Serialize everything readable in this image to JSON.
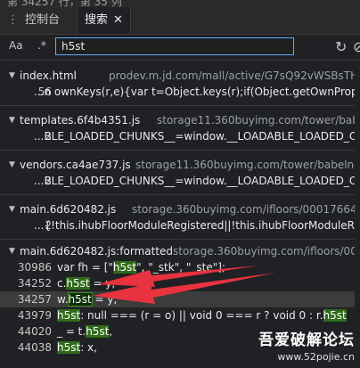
{
  "status": "第 34257 行，第 35 列",
  "tabs": {
    "console": "控制台",
    "search": "搜索",
    "close": "✕"
  },
  "search": {
    "case_toggle": "Aa",
    "regex_toggle": ".*",
    "query": "h5st"
  },
  "results": [
    {
      "file": "index.html",
      "url": "prodev.m.jd.com/mall/active/G7sQ92vWSBsTHzk4e953qU",
      "lines": [
        {
          "num": "56",
          "text": "...n ownKeys(r,e){var t=Object.keys(r);if(Object.getOwnPropertySymb"
        }
      ]
    },
    {
      "file": "templates.6f4b4351.js",
      "url": "storage11.360buyimg.com/tower/babelnode/",
      "lines": [
        {
          "num": "2",
          "text": "...BLE_LOADED_CHUNKS__=window.__LOADABLE_LOADED_CHUNKS_"
        }
      ]
    },
    {
      "file": "vendors.ca4ae737.js",
      "url": "storage11.360buyimg.com/tower/babelnode/js",
      "lines": [
        {
          "num": "2",
          "text": "...BLE_LOADED_CHUNKS__=window.__LOADABLE_LOADED_CHUNKS_"
        }
      ]
    },
    {
      "file": "main.6d620482.js",
      "url": "storage.360buyimg.com/ifloors/00017664/static/js",
      "lines": [
        {
          "num": "2",
          "text": "...{!this.ihubFloorModuleRegistered||!this.ihubFloorModuleRegistere"
        }
      ]
    },
    {
      "file": "main.6d620482.js:formatted",
      "url": "storage.360buyimg.com/ifloors/0001766",
      "lines": [
        {
          "num": "30986",
          "pre": "var fh = [\"",
          "hl": "h5st",
          "post": "\", \"_stk\", \"_ste\"];"
        },
        {
          "num": "34252",
          "pre": "c.",
          "hl": "h5st",
          "post": " = y,"
        },
        {
          "num": "34257",
          "pre": "w.",
          "hl": "h5st",
          "post": " = y,"
        },
        {
          "num": "43979",
          "pre": "",
          "hl": "h5st",
          "post": ": null === (r = o) || void 0 === r ? void 0 : r.",
          "hl2": "h5st"
        },
        {
          "num": "44020",
          "pre": "_ = t.",
          "hl": "h5st",
          "post": ","
        },
        {
          "num": "44038",
          "pre": "",
          "hl": "h5st",
          "post": ": x,"
        }
      ]
    }
  ],
  "watermark": {
    "title": "吾爱破解论坛",
    "url": "www.52pojie.cn"
  },
  "accent": {
    "arrow": "#e8323f",
    "highlight": "#2f6b1a",
    "input_border": "#5aa9ff"
  }
}
